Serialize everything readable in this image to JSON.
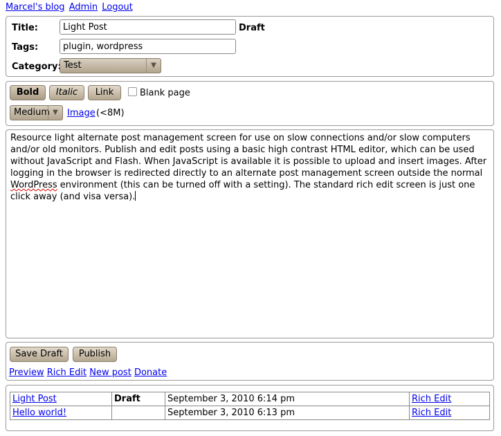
{
  "nav": {
    "blog": "Marcel's blog",
    "admin": "Admin",
    "logout": "Logout"
  },
  "meta": {
    "title_label": "Title:",
    "title_value": "Light Post",
    "status": "Draft",
    "tags_label": "Tags:",
    "tags_value": "plugin, wordpress",
    "category_label": "Category:",
    "category_value": "Test"
  },
  "toolbar": {
    "bold": "Bold",
    "italic": "Italic",
    "link": "Link",
    "blank_page": "Blank page",
    "size_value": "Medium",
    "image": "Image",
    "image_limit": "(<8M)"
  },
  "editor": {
    "text_before": "Resource light alternate post management screen for use on slow connections and/or slow computers and/or old monitors. Publish and edit posts using a basic high contrast HTML editor, which can be used without JavaScript and Flash. When JavaScript is available it is possible to upload and insert images. After logging in the browser is redirected directly to an alternate post management screen outside the normal ",
    "misspelled": "WordPress",
    "text_after": " environment (this can be turned off with a setting). The standard rich edit screen is just one click away (and visa versa)."
  },
  "actions": {
    "save_draft": "Save Draft",
    "publish": "Publish",
    "links": [
      "Preview",
      "Rich Edit",
      "New post",
      "Donate"
    ]
  },
  "posts": [
    {
      "title": "Light Post",
      "status": "Draft",
      "date": "September 3, 2010 6:14 pm",
      "edit": "Rich Edit"
    },
    {
      "title": "Hello world!",
      "status": "",
      "date": "September 3, 2010 6:13 pm",
      "edit": "Rich Edit"
    }
  ]
}
